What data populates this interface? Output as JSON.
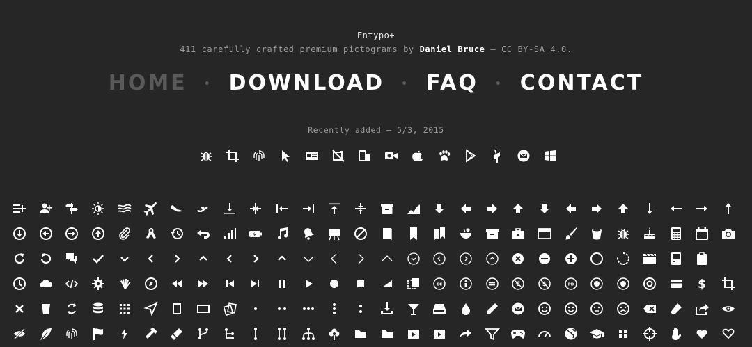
{
  "header": {
    "title": "Entypo+",
    "subtitle_prefix": "411 carefully crafted premium pictograms by ",
    "author": "Daniel Bruce",
    "subtitle_suffix": " — CC BY-SA 4.0."
  },
  "nav": {
    "items": [
      {
        "label": "HOME",
        "active": false
      },
      {
        "label": "DOWNLOAD",
        "active": true
      },
      {
        "label": "FAQ",
        "active": true
      },
      {
        "label": "CONTACT",
        "active": true
      }
    ],
    "separator": "•"
  },
  "recent": {
    "label": "Recently added — 5/3, 2015",
    "icons": [
      "bug-icon",
      "crop-icon",
      "fingerprint-icon",
      "cursor-icon",
      "id-card-icon",
      "camera-off-icon",
      "devices-icon",
      "video-icon",
      "apple-icon",
      "paw-icon",
      "google-play-icon",
      "shop-icon",
      "email-icon",
      "windows-icon"
    ]
  },
  "grid": {
    "rows": [
      [
        "add-to-list-icon",
        "add-user-icon",
        "address-icon",
        "adjust-icon",
        "air-icon",
        "aircraft-icon",
        "aircraft-landing-icon",
        "aircraft-take-off-icon",
        "align-bottom-icon",
        "align-horizontal-middle-icon",
        "align-left-icon",
        "align-right-icon",
        "align-top-icon",
        "align-vertical-middle-icon",
        "archive-icon",
        "area-graph-icon",
        "arrow-bold-down-icon",
        "arrow-bold-left-icon",
        "arrow-bold-right-icon",
        "arrow-bold-up-icon",
        "arrow-down-icon",
        "arrow-left-icon",
        "arrow-right-icon",
        "arrow-up-icon",
        "arrow-long-down-icon",
        "arrow-long-left-icon",
        "arrow-long-right-icon",
        "arrow-long-up-icon"
      ],
      [
        "arrow-with-circle-down-icon",
        "arrow-with-circle-left-icon",
        "arrow-with-circle-right-icon",
        "arrow-with-circle-up-icon",
        "attachment-icon",
        "awareness-ribbon-icon",
        "back-in-time-icon",
        "back-icon",
        "bar-graph-icon",
        "battery-icon",
        "beamed-note-icon",
        "bell-icon",
        "blackboard-icon",
        "block-icon",
        "book-icon",
        "bookmark-icon",
        "bookmarks-icon",
        "bowl-icon",
        "box-icon",
        "briefcase-icon",
        "browser-icon",
        "brush-icon",
        "bucket-icon",
        "bug-icon",
        "cake-icon",
        "calculator-icon",
        "calendar-icon",
        "camera-icon"
      ],
      [
        "ccw-icon",
        "cw-icon",
        "chat-icon",
        "check-icon",
        "chevron-down-icon",
        "chevron-left-icon",
        "chevron-right-icon",
        "chevron-up-icon",
        "chevron-small-left-icon",
        "chevron-small-right-icon",
        "chevron-small-up-icon",
        "chevron-thin-down-icon",
        "chevron-thin-left-icon",
        "chevron-thin-right-icon",
        "chevron-thin-up-icon",
        "chevron-circle-down-icon",
        "chevron-circle-left-icon",
        "chevron-circle-right-icon",
        "chevron-circle-up-icon",
        "circle-with-cross-icon",
        "circle-with-minus-icon",
        "circle-with-plus-icon",
        "circle-icon",
        "circular-graph-icon",
        "clapperboard-icon",
        "classic-computer-icon",
        "clipboard-icon"
      ],
      [
        "clock-icon",
        "cloud-icon",
        "code-icon",
        "cog-icon",
        "colours-icon",
        "compass-icon",
        "controller-fast-backward-icon",
        "controller-fast-forward-icon",
        "controller-jump-to-start-icon",
        "controller-next-icon",
        "controller-paus-icon",
        "controller-play-icon",
        "controller-record-icon",
        "controller-stop-icon",
        "controller-volume-icon",
        "copy-icon",
        "creative-commons-icon",
        "cc-attribution-icon",
        "cc-noderivs-icon",
        "cc-noncommercial-eu-icon",
        "cc-noncommercial-us-icon",
        "cc-public-domain-icon",
        "cc-remix-icon",
        "cc-share-icon",
        "cc-sharealike-icon",
        "credit-card-icon",
        "credit-icon",
        "crop-icon"
      ],
      [
        "cross-icon",
        "cup-icon",
        "cycle-icon",
        "database-icon",
        "dial-pad-icon",
        "direction-icon",
        "document-icon",
        "document-landscape-icon",
        "documents-icon",
        "dot-single-icon",
        "dots-two-horizontal-icon",
        "dots-three-horizontal-icon",
        "dots-three-vertical-icon",
        "dots-two-vertical-icon",
        "download-icon",
        "drink-icon",
        "drive-icon",
        "drop-icon",
        "edit-icon",
        "email-icon",
        "emoji-happy-icon",
        "emoji-neutral-icon",
        "emoji-flirt-icon",
        "emoji-sad-icon",
        "erase-icon",
        "eraser-icon",
        "export-icon",
        "eye-icon"
      ],
      [
        "eye-with-line-icon",
        "feather-icon",
        "fingerprint-icon",
        "flag-icon",
        "flash-icon",
        "flashlight-icon",
        "flat-brush-icon",
        "flow-branch-icon",
        "flow-cascade-icon",
        "flow-line-icon",
        "flow-parallel-icon",
        "flow-tree-icon",
        "flower-icon",
        "folder-icon",
        "folder-images-icon",
        "folder-music-icon",
        "folder-video-icon",
        "forward-icon",
        "funnel-icon",
        "game-controller-icon",
        "gauge-icon",
        "globe-icon",
        "graduation-cap-icon",
        "grid-icon",
        "hair-cross-icon",
        "hand-icon",
        "heart-icon",
        "heart-outlined-icon"
      ]
    ]
  }
}
